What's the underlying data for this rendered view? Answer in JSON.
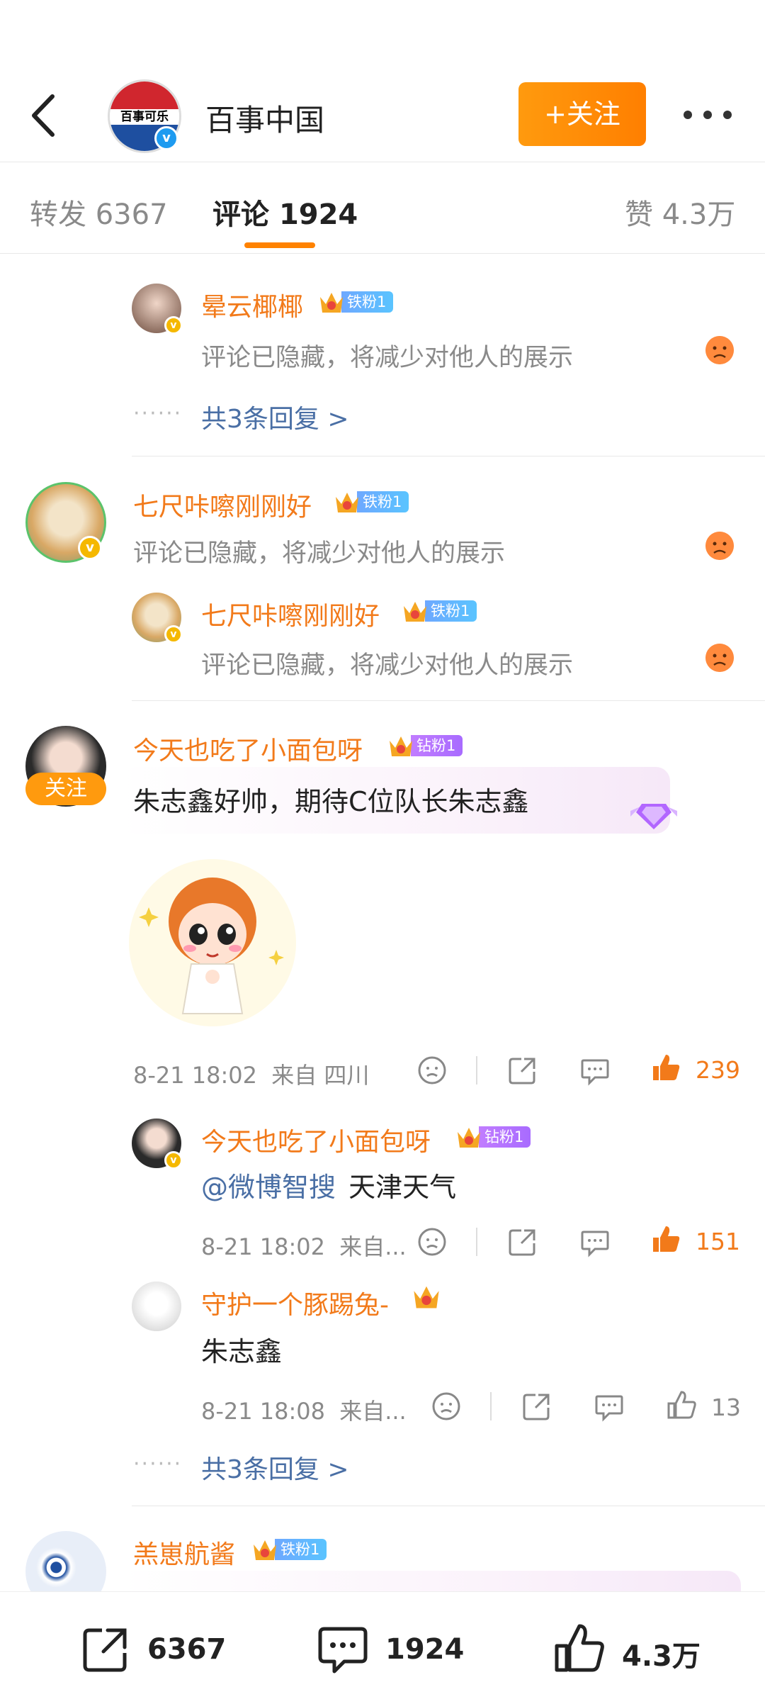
{
  "header": {
    "brand_logo_text": "百事可乐",
    "brand_name": "百事中国",
    "follow_label": "+关注"
  },
  "tabs": [
    {
      "label": "转发",
      "count": "6367"
    },
    {
      "label": "评论",
      "count": "1924"
    },
    {
      "label": "赞",
      "count": "4.3万"
    }
  ],
  "comments": {
    "c0": {
      "user": "晕云椰椰",
      "badge": "铁粉1",
      "badge_level": "6",
      "text": "评论已隐藏，将减少对他人的展示",
      "more_replies": "共3条回复 >"
    },
    "c1": {
      "user": "七尺咔嚓刚刚好",
      "badge": "铁粉1",
      "badge_level": "6",
      "text": "评论已隐藏，将减少对他人的展示",
      "reply_user": "七尺咔嚓刚刚好",
      "reply_badge": "铁粉1",
      "reply_text": "评论已隐藏，将减少对他人的展示"
    },
    "c2": {
      "user": "今天也吃了小面包呀",
      "badge": "钻粉1",
      "badge_level": "6",
      "avatar_follow": "关注",
      "text": "朱志鑫好帅，期待C位队长朱志鑫",
      "time": "8-21 18:02",
      "location": "来自 四川",
      "likes": "239",
      "reply1": {
        "user": "今天也吃了小面包呀",
        "badge": "钻粉1",
        "mention": "@微博智搜",
        "text": "天津天气",
        "time": "8-21 18:02",
        "location": "来自...",
        "likes": "151"
      },
      "reply2": {
        "user": "守护一个豚踢兔-",
        "badge_level": "4",
        "text": "朱志鑫",
        "time": "8-21 18:08",
        "location": "来自...",
        "likes": "13"
      },
      "more_replies": "共3条回复 >"
    },
    "c3": {
      "user": "羔崽航酱",
      "badge": "铁粉1",
      "badge_level": "6"
    }
  },
  "bottom": {
    "share_count": "6367",
    "comment_count": "1924",
    "like_count": "4.3万"
  },
  "colors": {
    "accent": "#FF8200",
    "username": "#F27A1A",
    "link": "#4A6FA5"
  }
}
